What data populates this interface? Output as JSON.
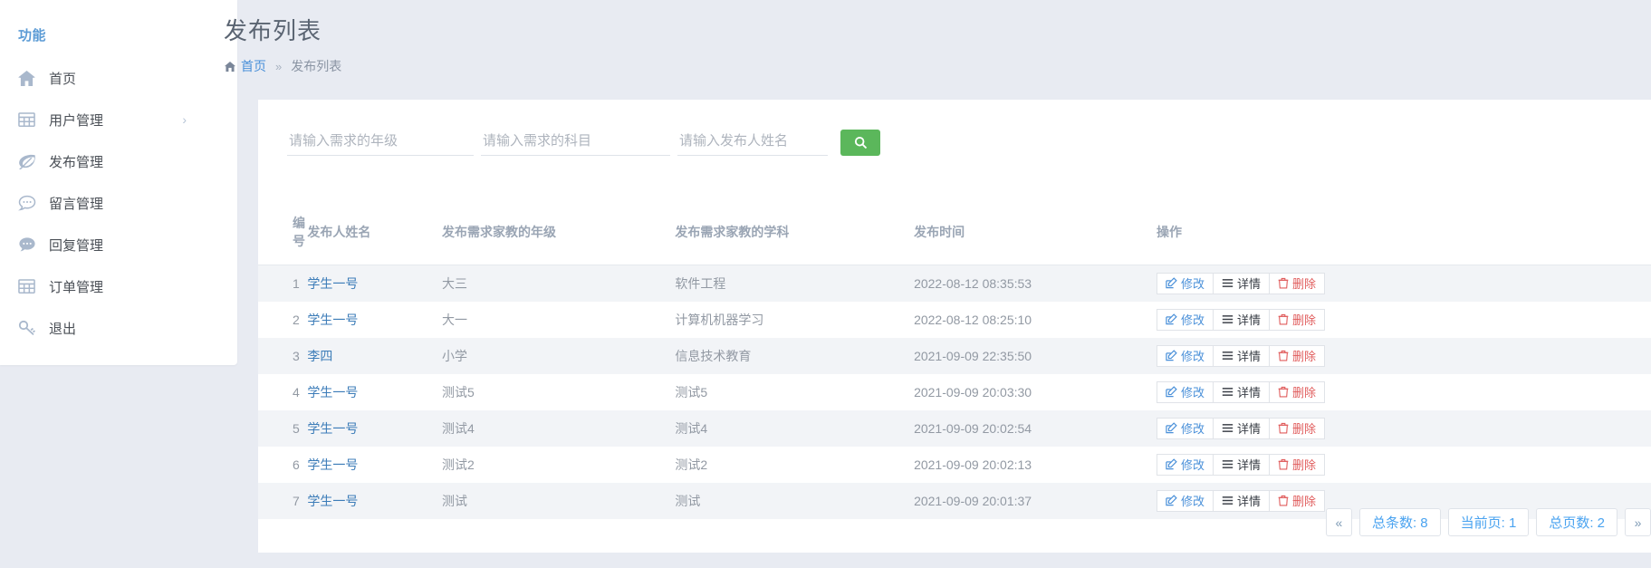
{
  "sidebar": {
    "title": "功能",
    "items": [
      {
        "label": "首页",
        "icon": "home-icon",
        "expandable": false
      },
      {
        "label": "用户管理",
        "icon": "table-icon",
        "expandable": true,
        "chevron": "›"
      },
      {
        "label": "发布管理",
        "icon": "leaf-icon",
        "expandable": false
      },
      {
        "label": "留言管理",
        "icon": "comment-icon",
        "expandable": false
      },
      {
        "label": "回复管理",
        "icon": "comments-icon",
        "expandable": false
      },
      {
        "label": "订单管理",
        "icon": "table-icon",
        "expandable": false
      },
      {
        "label": "退出",
        "icon": "key-icon",
        "expandable": false
      }
    ]
  },
  "header": {
    "title": "发布列表",
    "breadcrumb": {
      "home_icon": "home-icon",
      "home_label": "首页",
      "separator": "»",
      "current": "发布列表"
    }
  },
  "filters": {
    "grade": {
      "placeholder": "请输入需求的年级",
      "value": ""
    },
    "subject": {
      "placeholder": "请输入需求的科目",
      "value": ""
    },
    "person": {
      "placeholder": "请输入发布人姓名",
      "value": ""
    },
    "search_button": {
      "icon": "search-icon",
      "color": "#5bb75b"
    }
  },
  "table": {
    "columns": [
      "编号",
      "发布人姓名",
      "发布需求家教的年级",
      "发布需求家教的学科",
      "发布时间",
      "操作"
    ],
    "actions": [
      {
        "label": "修改",
        "icon": "edit-icon",
        "color": "#4a90d9"
      },
      {
        "label": "详情",
        "icon": "list-icon",
        "color": "#3a3f47"
      },
      {
        "label": "删除",
        "icon": "trash-icon",
        "color": "#e05c5c"
      }
    ],
    "rows": [
      {
        "id": "1",
        "name": "学生一号",
        "grade": "大三",
        "subject": "软件工程",
        "time": "2022-08-12 08:35:53"
      },
      {
        "id": "2",
        "name": "学生一号",
        "grade": "大一",
        "subject": "计算机机器学习",
        "time": "2022-08-12 08:25:10"
      },
      {
        "id": "3",
        "name": "李四",
        "grade": "小学",
        "subject": "信息技术教育",
        "time": "2021-09-09 22:35:50"
      },
      {
        "id": "4",
        "name": "学生一号",
        "grade": "测试5",
        "subject": "测试5",
        "time": "2021-09-09 20:03:30"
      },
      {
        "id": "5",
        "name": "学生一号",
        "grade": "测试4",
        "subject": "测试4",
        "time": "2021-09-09 20:02:54"
      },
      {
        "id": "6",
        "name": "学生一号",
        "grade": "测试2",
        "subject": "测试2",
        "time": "2021-09-09 20:02:13"
      },
      {
        "id": "7",
        "name": "学生一号",
        "grade": "测试",
        "subject": "测试",
        "time": "2021-09-09 20:01:37"
      }
    ]
  },
  "pagination": {
    "prev": "«",
    "next": "»",
    "total_records": "总条数: 8",
    "current_page": "当前页: 1",
    "total_pages": "总页数: 2"
  },
  "colors": {
    "page_background": "#e8ebf2",
    "card_background": "#ffffff",
    "accent_blue": "#4a90d9",
    "sidebar_title": "#5b9bd5",
    "search_green": "#5bb75b",
    "danger_red": "#e05c5c",
    "row_stripe": "#f2f4f7"
  }
}
